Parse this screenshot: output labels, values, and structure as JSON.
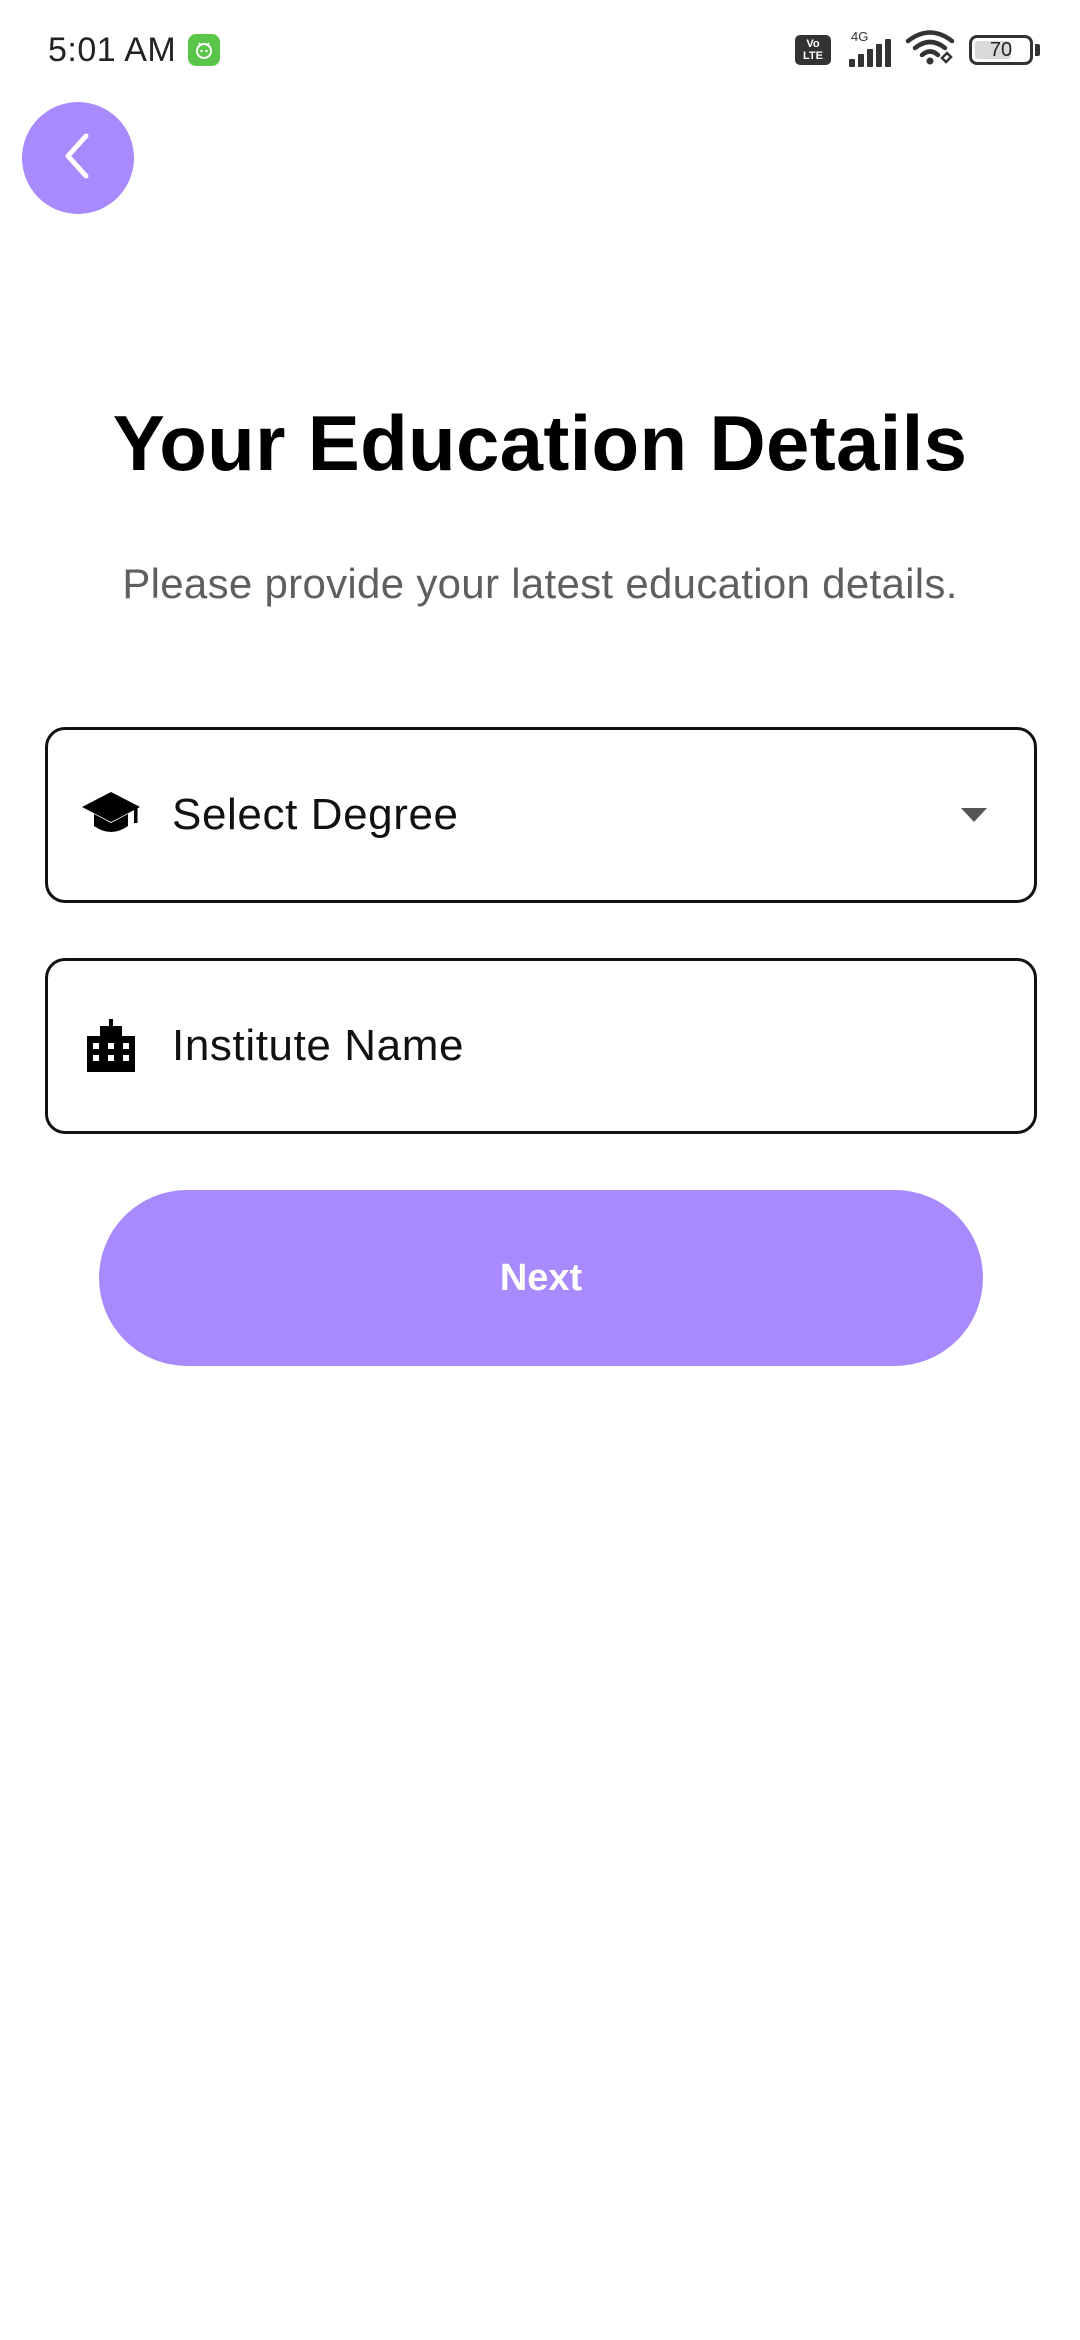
{
  "status_bar": {
    "time": "5:01 AM",
    "app_badge_icon": "android-bot-icon",
    "volte_label_top": "Vo",
    "volte_label_bottom": "LTE",
    "network_label": "4G",
    "battery_level": "70",
    "battery_fraction": 0.7
  },
  "nav": {
    "back_icon": "chevron-left-icon"
  },
  "header": {
    "title": "Your Education Details",
    "subtitle": "Please provide your latest education details."
  },
  "form": {
    "degree": {
      "icon": "graduation-cap-icon",
      "placeholder": "Select Degree",
      "value": "",
      "arrow_icon": "caret-down-icon"
    },
    "institute": {
      "icon": "building-icon",
      "placeholder": "Institute Name",
      "value": ""
    }
  },
  "actions": {
    "next_label": "Next"
  },
  "colors": {
    "accent": "#a88afc",
    "title": "#000000",
    "subtitle": "#5f5f5f",
    "field_border": "#111111"
  }
}
